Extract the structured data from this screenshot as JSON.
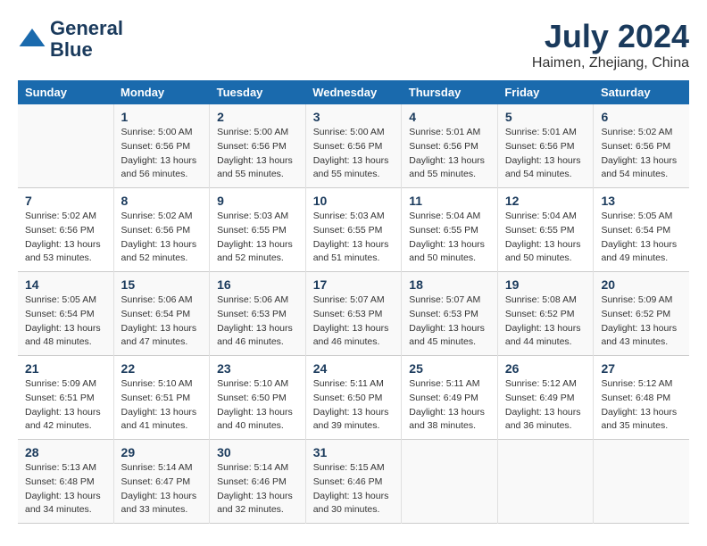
{
  "logo": {
    "line1": "General",
    "line2": "Blue"
  },
  "title": "July 2024",
  "subtitle": "Haimen, Zhejiang, China",
  "days_header": [
    "Sunday",
    "Monday",
    "Tuesday",
    "Wednesday",
    "Thursday",
    "Friday",
    "Saturday"
  ],
  "weeks": [
    [
      {
        "num": "",
        "info": ""
      },
      {
        "num": "1",
        "info": "Sunrise: 5:00 AM\nSunset: 6:56 PM\nDaylight: 13 hours\nand 56 minutes."
      },
      {
        "num": "2",
        "info": "Sunrise: 5:00 AM\nSunset: 6:56 PM\nDaylight: 13 hours\nand 55 minutes."
      },
      {
        "num": "3",
        "info": "Sunrise: 5:00 AM\nSunset: 6:56 PM\nDaylight: 13 hours\nand 55 minutes."
      },
      {
        "num": "4",
        "info": "Sunrise: 5:01 AM\nSunset: 6:56 PM\nDaylight: 13 hours\nand 55 minutes."
      },
      {
        "num": "5",
        "info": "Sunrise: 5:01 AM\nSunset: 6:56 PM\nDaylight: 13 hours\nand 54 minutes."
      },
      {
        "num": "6",
        "info": "Sunrise: 5:02 AM\nSunset: 6:56 PM\nDaylight: 13 hours\nand 54 minutes."
      }
    ],
    [
      {
        "num": "7",
        "info": "Sunrise: 5:02 AM\nSunset: 6:56 PM\nDaylight: 13 hours\nand 53 minutes."
      },
      {
        "num": "8",
        "info": "Sunrise: 5:02 AM\nSunset: 6:56 PM\nDaylight: 13 hours\nand 52 minutes."
      },
      {
        "num": "9",
        "info": "Sunrise: 5:03 AM\nSunset: 6:55 PM\nDaylight: 13 hours\nand 52 minutes."
      },
      {
        "num": "10",
        "info": "Sunrise: 5:03 AM\nSunset: 6:55 PM\nDaylight: 13 hours\nand 51 minutes."
      },
      {
        "num": "11",
        "info": "Sunrise: 5:04 AM\nSunset: 6:55 PM\nDaylight: 13 hours\nand 50 minutes."
      },
      {
        "num": "12",
        "info": "Sunrise: 5:04 AM\nSunset: 6:55 PM\nDaylight: 13 hours\nand 50 minutes."
      },
      {
        "num": "13",
        "info": "Sunrise: 5:05 AM\nSunset: 6:54 PM\nDaylight: 13 hours\nand 49 minutes."
      }
    ],
    [
      {
        "num": "14",
        "info": "Sunrise: 5:05 AM\nSunset: 6:54 PM\nDaylight: 13 hours\nand 48 minutes."
      },
      {
        "num": "15",
        "info": "Sunrise: 5:06 AM\nSunset: 6:54 PM\nDaylight: 13 hours\nand 47 minutes."
      },
      {
        "num": "16",
        "info": "Sunrise: 5:06 AM\nSunset: 6:53 PM\nDaylight: 13 hours\nand 46 minutes."
      },
      {
        "num": "17",
        "info": "Sunrise: 5:07 AM\nSunset: 6:53 PM\nDaylight: 13 hours\nand 46 minutes."
      },
      {
        "num": "18",
        "info": "Sunrise: 5:07 AM\nSunset: 6:53 PM\nDaylight: 13 hours\nand 45 minutes."
      },
      {
        "num": "19",
        "info": "Sunrise: 5:08 AM\nSunset: 6:52 PM\nDaylight: 13 hours\nand 44 minutes."
      },
      {
        "num": "20",
        "info": "Sunrise: 5:09 AM\nSunset: 6:52 PM\nDaylight: 13 hours\nand 43 minutes."
      }
    ],
    [
      {
        "num": "21",
        "info": "Sunrise: 5:09 AM\nSunset: 6:51 PM\nDaylight: 13 hours\nand 42 minutes."
      },
      {
        "num": "22",
        "info": "Sunrise: 5:10 AM\nSunset: 6:51 PM\nDaylight: 13 hours\nand 41 minutes."
      },
      {
        "num": "23",
        "info": "Sunrise: 5:10 AM\nSunset: 6:50 PM\nDaylight: 13 hours\nand 40 minutes."
      },
      {
        "num": "24",
        "info": "Sunrise: 5:11 AM\nSunset: 6:50 PM\nDaylight: 13 hours\nand 39 minutes."
      },
      {
        "num": "25",
        "info": "Sunrise: 5:11 AM\nSunset: 6:49 PM\nDaylight: 13 hours\nand 38 minutes."
      },
      {
        "num": "26",
        "info": "Sunrise: 5:12 AM\nSunset: 6:49 PM\nDaylight: 13 hours\nand 36 minutes."
      },
      {
        "num": "27",
        "info": "Sunrise: 5:12 AM\nSunset: 6:48 PM\nDaylight: 13 hours\nand 35 minutes."
      }
    ],
    [
      {
        "num": "28",
        "info": "Sunrise: 5:13 AM\nSunset: 6:48 PM\nDaylight: 13 hours\nand 34 minutes."
      },
      {
        "num": "29",
        "info": "Sunrise: 5:14 AM\nSunset: 6:47 PM\nDaylight: 13 hours\nand 33 minutes."
      },
      {
        "num": "30",
        "info": "Sunrise: 5:14 AM\nSunset: 6:46 PM\nDaylight: 13 hours\nand 32 minutes."
      },
      {
        "num": "31",
        "info": "Sunrise: 5:15 AM\nSunset: 6:46 PM\nDaylight: 13 hours\nand 30 minutes."
      },
      {
        "num": "",
        "info": ""
      },
      {
        "num": "",
        "info": ""
      },
      {
        "num": "",
        "info": ""
      }
    ]
  ]
}
